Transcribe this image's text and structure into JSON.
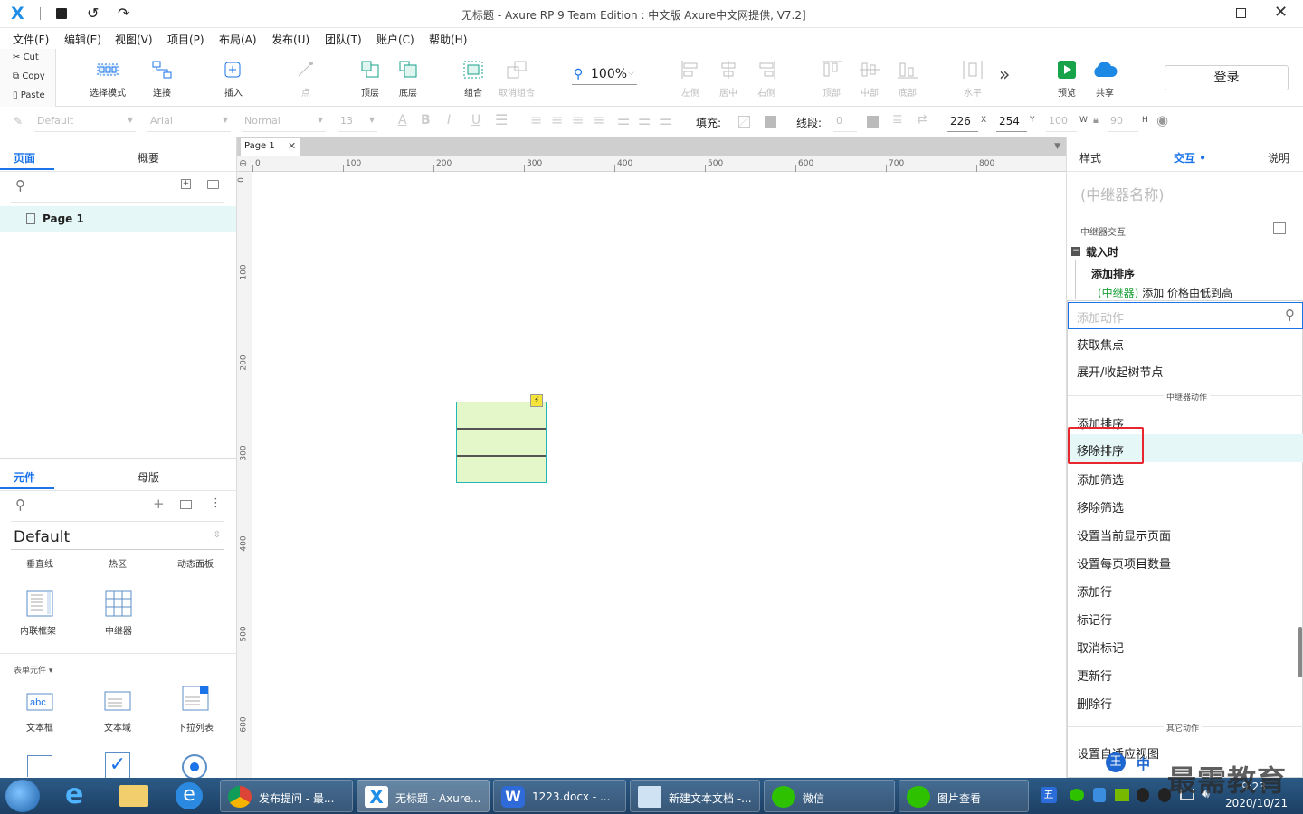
{
  "titlebar": {
    "title": "无标题 - Axure RP 9 Team Edition : 中文版    Axure中文网提供,  V7.2]"
  },
  "menubar": [
    "文件(F)",
    "编辑(E)",
    "视图(V)",
    "项目(P)",
    "布局(A)",
    "发布(U)",
    "团队(T)",
    "账户(C)",
    "帮助(H)"
  ],
  "clipboard": {
    "cut": "Cut",
    "copy": "Copy",
    "paste": "Paste"
  },
  "toolbar": {
    "select_mode": "选择模式",
    "connect": "连接",
    "insert": "插入",
    "point": "点",
    "zoom": "100%",
    "top": "顶层",
    "bottom": "底层",
    "group": "组合",
    "ungroup": "取消组合",
    "align_left": "左侧",
    "align_center": "居中",
    "align_right": "右侧",
    "align_top": "顶部",
    "align_middle": "中部",
    "align_bottom": "底部",
    "distribute": "水平",
    "more": "»",
    "preview": "预览",
    "share": "共享",
    "login": "登录"
  },
  "stylebar": {
    "style": "Default",
    "font": "Arial",
    "weight": "Normal",
    "size": "13",
    "fill_label": "填充:",
    "line_label": "线段:",
    "line_value": "0",
    "x": "226",
    "x_label": "X",
    "y": "254",
    "y_label": "Y",
    "w": "100",
    "w_label": "W",
    "h": "90",
    "h_label": "H"
  },
  "leftpanel": {
    "tab_pages": "页面",
    "tab_outline": "概要",
    "page_item": "Page 1",
    "tab_widgets": "元件",
    "tab_masters": "母版",
    "library": "Default",
    "row1": [
      "垂直线",
      "热区",
      "动态面板"
    ],
    "row2": [
      "内联框架",
      "中继器"
    ],
    "form_section": "表单元件 ▾",
    "row3": [
      "文本框",
      "文本域",
      "下拉列表"
    ]
  },
  "canvas": {
    "tab": "Page 1",
    "ruler_h": [
      "0",
      "100",
      "200",
      "300",
      "400",
      "500",
      "600",
      "700",
      "800"
    ],
    "ruler_v": [
      "0",
      "100",
      "200",
      "300",
      "400",
      "500",
      "600"
    ]
  },
  "rightpanel": {
    "tab_style": "样式",
    "tab_interact": "交互",
    "tab_notes": "说明",
    "name_placeholder": "(中继器名称)",
    "section": "中继器交互",
    "event": "载入时",
    "action": "添加排序",
    "action_detail_target": "(中继器)",
    "action_detail": " 添加 价格由低到高",
    "search_placeholder": "添加动作",
    "items_top": [
      "获取焦点",
      "展开/收起树节点"
    ],
    "group_repeater": "中继器动作",
    "items": [
      "添加排序",
      "移除排序",
      "添加筛选",
      "移除筛选",
      "设置当前显示页面",
      "设置每页项目数量",
      "添加行",
      "标记行",
      "取消标记",
      "更新行",
      "删除行"
    ],
    "group_other": "其它动作",
    "item_last": "设置自适应视图"
  },
  "taskbar": {
    "tasks": [
      "发布提问 - 最...",
      "无标题 - Axure...",
      "1223.docx - ...",
      "新建文本文档 -...",
      "微信",
      "图片查看"
    ],
    "ime": "中",
    "time": "9:23",
    "date": "2020/10/21",
    "watermark": "最需教育"
  },
  "colors": {
    "accent": "#1a73e8",
    "highlight": "#e5f7f7",
    "selected_box": "#e8262d",
    "repeater_fill": "#e3f7c9"
  }
}
